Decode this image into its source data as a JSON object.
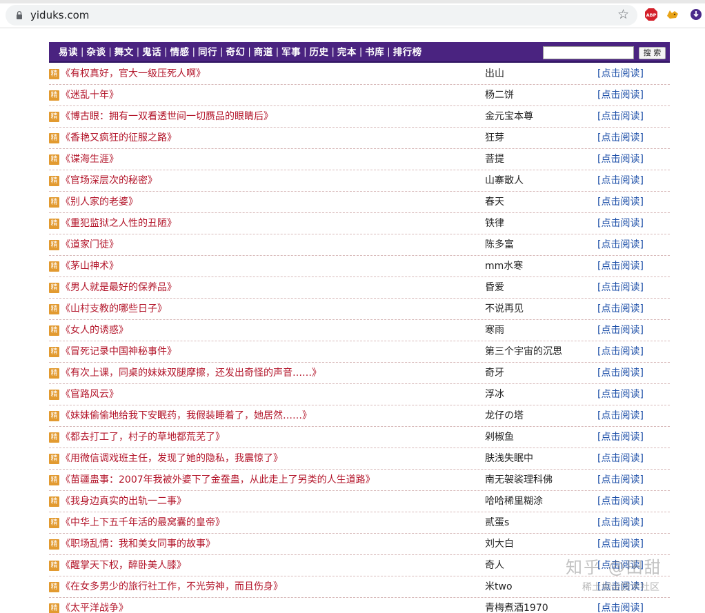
{
  "browser": {
    "url": "yiduks.com"
  },
  "nav": {
    "links": [
      "易读",
      "杂谈",
      "舞文",
      "鬼话",
      "情感",
      "同行",
      "奇幻",
      "商道",
      "军事",
      "历史",
      "完本",
      "书库",
      "排行榜"
    ],
    "separator": "|",
    "search_value": "",
    "search_button": "搜 索"
  },
  "badge_label": "精",
  "books": [
    {
      "title": "《有权真好，官大一级压死人啊》",
      "author": "出山",
      "link": "[点击阅读]"
    },
    {
      "title": "《迷乱十年》",
      "author": "杨二饼",
      "link": "[点击阅读]"
    },
    {
      "title": "《博古眼：拥有一双看透世间一切赝品的眼睛后》",
      "author": "金元宝本尊",
      "link": "[点击阅读]"
    },
    {
      "title": "《香艳又疯狂的征服之路》",
      "author": "狂芽",
      "link": "[点击阅读]"
    },
    {
      "title": "《谍海生涯》",
      "author": "菩提",
      "link": "[点击阅读]"
    },
    {
      "title": "《官场深层次的秘密》",
      "author": "山寨散人",
      "link": "[点击阅读]"
    },
    {
      "title": "《别人家的老婆》",
      "author": "春天",
      "link": "[点击阅读]"
    },
    {
      "title": "《重犯监狱之人性的丑陋》",
      "author": "铁律",
      "link": "[点击阅读]"
    },
    {
      "title": "《道家门徒》",
      "author": "陈多富",
      "link": "[点击阅读]"
    },
    {
      "title": "《茅山神术》",
      "author": "mm水寒",
      "link": "[点击阅读]"
    },
    {
      "title": "《男人就是最好的保养品》",
      "author": "昏爱",
      "link": "[点击阅读]"
    },
    {
      "title": "《山村支教的哪些日子》",
      "author": "不说再见",
      "link": "[点击阅读]"
    },
    {
      "title": "《女人的诱惑》",
      "author": "寒雨",
      "link": "[点击阅读]"
    },
    {
      "title": "《冒死记录中国神秘事件》",
      "author": "第三个宇宙的沉思",
      "link": "[点击阅读]"
    },
    {
      "title": "《有次上课，同桌的妹妹双腿摩擦，还发出奇怪的声音……》",
      "author": "奇牙",
      "link": "[点击阅读]"
    },
    {
      "title": "《官路风云》",
      "author": "浮冰",
      "link": "[点击阅读]"
    },
    {
      "title": "《妹妹偷偷地给我下安眠药，我假装睡着了，她居然……》",
      "author": "龙仔の塔",
      "link": "[点击阅读]"
    },
    {
      "title": "《都去打工了，村子的草地都荒芜了》",
      "author": "剁椒鱼",
      "link": "[点击阅读]"
    },
    {
      "title": "《用微信调戏班主任，发现了她的隐私，我震惊了》",
      "author": "肤浅失眠中",
      "link": "[点击阅读]"
    },
    {
      "title": "《苗疆蛊事：2007年我被外婆下了金蚕蛊，从此走上了另类的人生道路》",
      "author": "南无袈裟理科佛",
      "link": "[点击阅读]"
    },
    {
      "title": "《我身边真实的出轨一二事》",
      "author": "哈哈稀里糊涂",
      "link": "[点击阅读]"
    },
    {
      "title": "《中华上下五千年活的最窝囊的皇帝》",
      "author": "贰蛋s",
      "link": "[点击阅读]"
    },
    {
      "title": "《职场乱情：我和美女同事的故事》",
      "author": "刘大白",
      "link": "[点击阅读]"
    },
    {
      "title": "《醒掌天下权，醉卧美人膝》",
      "author": "奇人",
      "link": "[点击阅读]"
    },
    {
      "title": "《在女多男少的旅行社工作，不光劳神，而且伤身》",
      "author": "米two",
      "link": "[点击阅读]"
    },
    {
      "title": "《太平洋战争》",
      "author": "青梅煮酒1970",
      "link": "[点击阅读]"
    }
  ],
  "watermark": {
    "main": "知乎 @田甜",
    "sub": "稀土掘金技术社区"
  }
}
